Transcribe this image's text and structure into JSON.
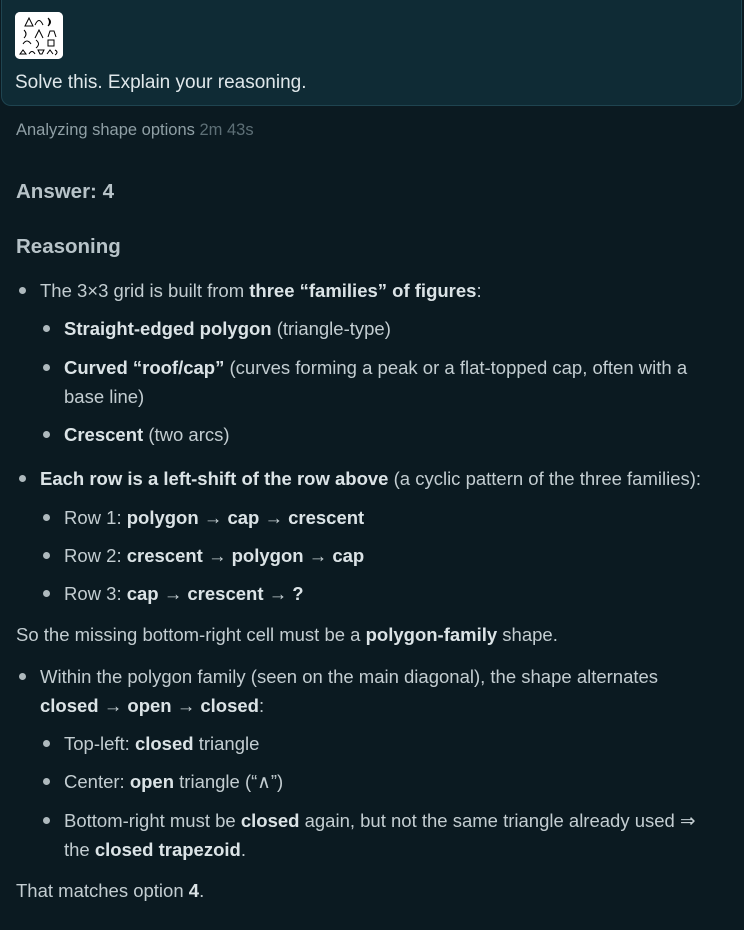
{
  "user_message": {
    "text": "Solve this. Explain your reasoning."
  },
  "status": {
    "label": "Analyzing shape options",
    "duration": "2m 43s"
  },
  "answer": {
    "label": "Answer:",
    "value": "4"
  },
  "reasoning": {
    "heading": "Reasoning",
    "b1": {
      "pre": "The 3×3 grid is built from ",
      "bold": "three “families” of figures",
      "post": ":"
    },
    "b1a": {
      "bold": "Straight-edged polygon",
      "rest": " (triangle-type)"
    },
    "b1b": {
      "bold": "Curved “roof/cap”",
      "rest_line1": " (curves forming a peak or a flat-topped cap, often with a",
      "rest_line2": "base line)"
    },
    "b1c": {
      "bold": "Crescent",
      "rest": " (two arcs)"
    },
    "b2": {
      "bold": "Each row is a left-shift of the row above",
      "rest": " (a cyclic pattern of the three families):"
    },
    "row1": {
      "label": "Row 1: ",
      "a": "polygon",
      "arrow1": " → ",
      "b": "cap",
      "arrow2": " → ",
      "c": "crescent"
    },
    "row2": {
      "label": "Row 2: ",
      "a": "crescent",
      "arrow1": " → ",
      "b": "polygon",
      "arrow2": " → ",
      "c": "cap"
    },
    "row3": {
      "label": "Row 3: ",
      "a": "cap",
      "arrow1": " → ",
      "b": "crescent",
      "arrow2": " → ",
      "c": "?"
    },
    "conclusion1": {
      "pre": "So the missing bottom-right cell must be a ",
      "bold": "polygon-family",
      "post": " shape."
    },
    "b3": {
      "line1": "Within the polygon family (seen on the main diagonal), the shape alternates",
      "w1": "closed",
      "arrow1": " → ",
      "w2": "open",
      "arrow2": " → ",
      "w3": "closed",
      "post": ":"
    },
    "b3a": {
      "pre": "Top-left: ",
      "bold": "closed",
      "post": " triangle"
    },
    "b3b": {
      "pre": "Center: ",
      "bold": "open",
      "post": " triangle (“∧”)"
    },
    "b3c": {
      "pre": "Bottom-right must be ",
      "bold1": "closed",
      "mid": " again, but not the same triangle already used ⇒",
      "pre2": "the ",
      "bold2": "closed trapezoid",
      "post2": "."
    },
    "final": {
      "pre": "That matches option ",
      "bold": "4",
      "post": "."
    }
  }
}
